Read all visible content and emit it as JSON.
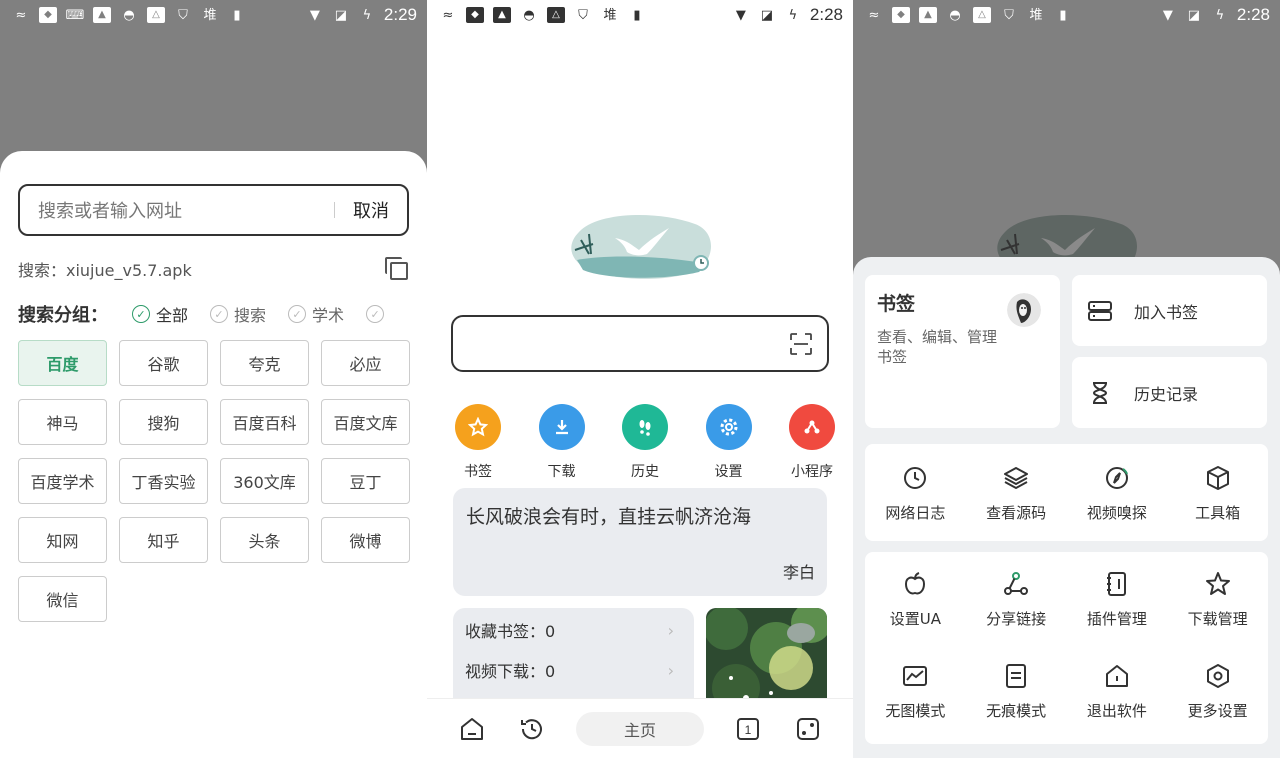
{
  "status_bars": [
    {
      "time": "2:29"
    },
    {
      "time": "2:28"
    },
    {
      "time": "2:28"
    }
  ],
  "search_panel": {
    "placeholder": "搜索或者输入网址",
    "cancel_label": "取消",
    "suggestion": "搜索：xiujue_v5.7.apk",
    "group_title": "搜索分组：",
    "groups": [
      {
        "label": "全部",
        "active": true
      },
      {
        "label": "搜索",
        "active": false
      },
      {
        "label": "学术",
        "active": false
      }
    ],
    "engines": [
      {
        "label": "百度",
        "active": true
      },
      {
        "label": "谷歌"
      },
      {
        "label": "夸克"
      },
      {
        "label": "必应"
      },
      {
        "label": "神马"
      },
      {
        "label": "搜狗"
      },
      {
        "label": "百度百科"
      },
      {
        "label": "百度文库"
      },
      {
        "label": "百度学术"
      },
      {
        "label": "丁香实验"
      },
      {
        "label": "360文库"
      },
      {
        "label": "豆丁"
      },
      {
        "label": "知网"
      },
      {
        "label": "知乎"
      },
      {
        "label": "头条"
      },
      {
        "label": "微博"
      },
      {
        "label": "微信"
      }
    ],
    "accent": "#2e9b6a"
  },
  "home_panel": {
    "quick_links": [
      {
        "label": "书签",
        "icon": "star-icon",
        "color": "#f5a11d"
      },
      {
        "label": "下载",
        "icon": "download-icon",
        "color": "#3a9be8"
      },
      {
        "label": "历史",
        "icon": "footprints-icon",
        "color": "#1fb896"
      },
      {
        "label": "设置",
        "icon": "gear-icon",
        "color": "#3a9be8"
      },
      {
        "label": "小程序",
        "icon": "miniapp-icon",
        "color": "#f04a3f"
      }
    ],
    "quote_text": "长风破浪会有时，直挂云帆济沧海",
    "quote_author": "李白",
    "stats": [
      {
        "label": "收藏书签：0"
      },
      {
        "label": "视频下载：0"
      }
    ],
    "home_tab": "主页",
    "tab_count": "1"
  },
  "menu_panel": {
    "bookmarks_title": "书签",
    "bookmarks_desc": "查看、编辑、管理书签",
    "add_bookmark": "加入书签",
    "history": "历史记录",
    "tools_row": [
      {
        "label": "网络日志",
        "icon": "clock-icon"
      },
      {
        "label": "查看源码",
        "icon": "layers-icon"
      },
      {
        "label": "视频嗅探",
        "icon": "compass-icon"
      },
      {
        "label": "工具箱",
        "icon": "box-icon"
      }
    ],
    "settings_rows": [
      {
        "label": "设置UA",
        "icon": "apple-icon"
      },
      {
        "label": "分享链接",
        "icon": "share-icon"
      },
      {
        "label": "插件管理",
        "icon": "plugin-icon"
      },
      {
        "label": "下载管理",
        "icon": "star-outline-icon"
      },
      {
        "label": "无图模式",
        "icon": "image-chart-icon"
      },
      {
        "label": "无痕模式",
        "icon": "document-icon"
      },
      {
        "label": "退出软件",
        "icon": "home-exit-icon"
      },
      {
        "label": "更多设置",
        "icon": "hexagon-settings-icon"
      }
    ]
  }
}
